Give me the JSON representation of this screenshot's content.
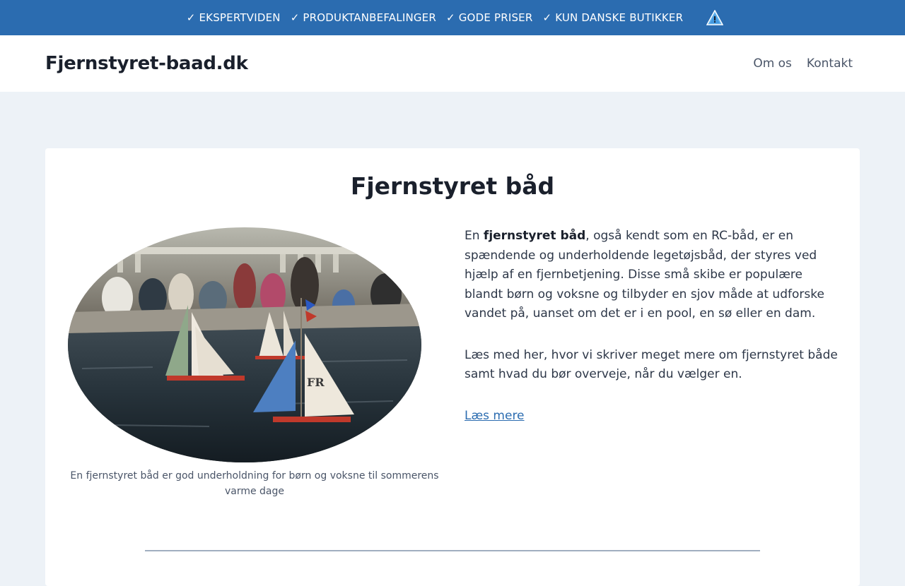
{
  "topbar": {
    "usps": [
      "✓ EKSPERTVIDEN",
      "✓ PRODUKTANBEFALINGER",
      "✓ GODE PRISER",
      "✓ KUN DANSKE BUTIKKER"
    ],
    "warning_icon": "warning-triangle-icon"
  },
  "header": {
    "brand": "Fjernstyret-baad.dk",
    "nav": [
      "Om os",
      "Kontakt"
    ]
  },
  "article": {
    "title": "Fjernstyret båd",
    "image_caption": "En fjernstyret båd er god underholdning for børn og voksne til sommerens varme dage",
    "intro_prefix": "En ",
    "intro_bold": "fjernstyret båd",
    "intro_rest": ", også kendt som en RC-båd, er en spændende og underholdende legetøjsbåd, der styres ved hjælp af en fjernbetjening. Disse små skibe er populære blandt børn og voksne og tilbyder en sjov måde at udforske vandet på, uanset om det er i en pool, en sø eller en dam.",
    "paragraph2": "Læs med her, hvor vi skriver meget mere om fjernstyret både samt hvad du bør overveje, når du vælger en.",
    "read_more": "Læs mere"
  },
  "colors": {
    "topbar": "#2b6cb0",
    "page_bg": "#edf2f7",
    "link": "#2b6cb0"
  }
}
